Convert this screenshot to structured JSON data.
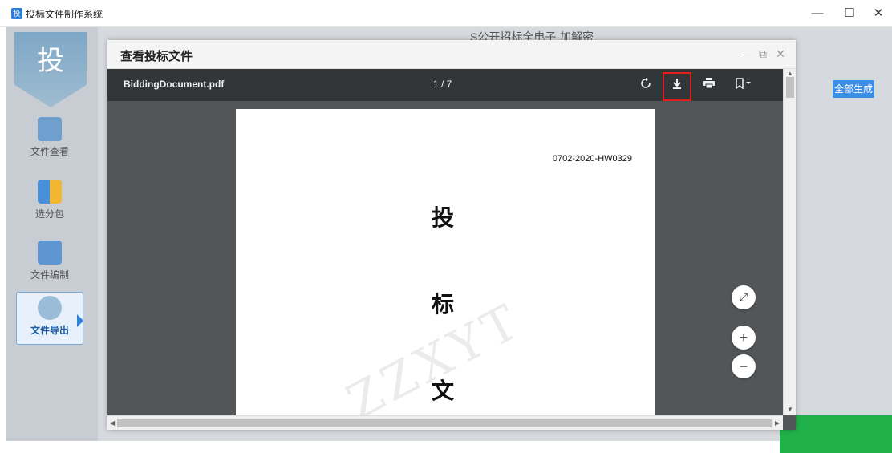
{
  "window": {
    "title": "投标文件制作系统",
    "icon_text": "投",
    "controls": {
      "minimize": "—",
      "maximize": "☐",
      "close": "✕"
    }
  },
  "sidebar": {
    "logo": "投",
    "items": [
      {
        "label": "文件查看",
        "icon": "check-document-icon"
      },
      {
        "label": "选分包",
        "icon": "package-grid-icon"
      },
      {
        "label": "文件编制",
        "icon": "edit-document-icon"
      },
      {
        "label": "文件导出",
        "icon": "export-gear-icon",
        "active": true
      }
    ]
  },
  "background": {
    "header_text": "S公开招标全电子-加解密",
    "generate_all_label": "全部生成"
  },
  "modal": {
    "title": "查看投标文件",
    "controls": {
      "minimize": "—",
      "restore": "⧉",
      "close": "✕"
    }
  },
  "viewer": {
    "filename": "BiddingDocument.pdf",
    "page_indicator": "1 / 7",
    "toolbar_icons": [
      "rotate-icon",
      "download-icon",
      "print-icon",
      "bookmark-icon"
    ],
    "document": {
      "doc_number": "0702-2020-HW0329",
      "chars": [
        "投",
        "标",
        "文"
      ],
      "watermark": "ZZXYT"
    },
    "zoom": {
      "fit": "⤢",
      "in": "+",
      "out": "−"
    }
  },
  "colors": {
    "accent": "#3a8ee6",
    "highlight": "#e02020",
    "viewer_toolbar": "#323639",
    "green_bar": "#21b14a"
  }
}
